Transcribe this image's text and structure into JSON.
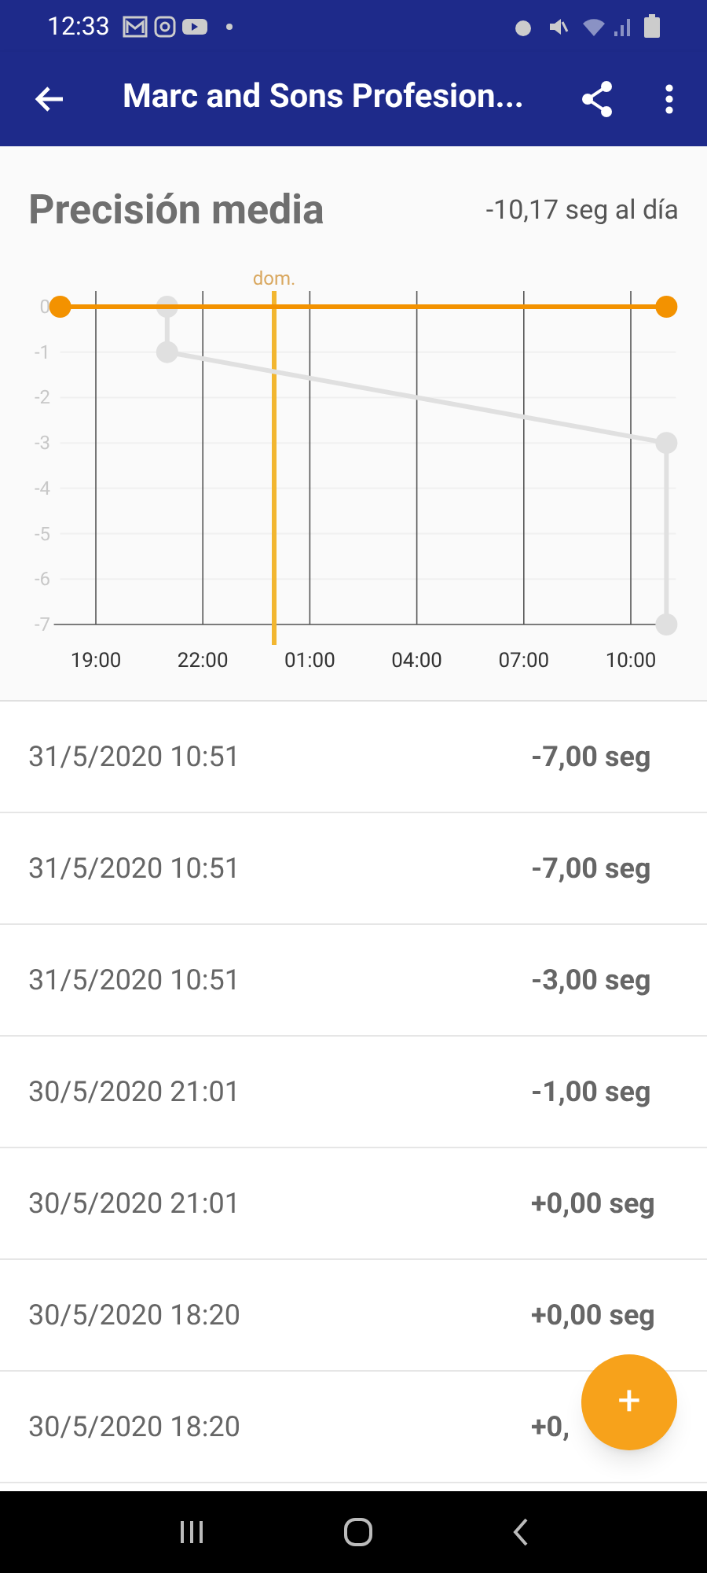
{
  "status_bar": {
    "time": "12:33"
  },
  "app_bar": {
    "title": "Marc and Sons Profesion..."
  },
  "summary": {
    "title": "Precisión media",
    "value": "-10,17 seg al día"
  },
  "chart": {
    "chart_data": {
      "type": "line",
      "grid": true,
      "categories": [
        null,
        "19:00",
        null,
        null,
        "22:00",
        null,
        null,
        "01:00",
        null,
        null,
        "04:00",
        null,
        null,
        "07:00",
        null,
        null,
        "10:00",
        null
      ],
      "ylim": [
        -7,
        0
      ],
      "yticks": [
        0,
        -1,
        -2,
        -3,
        -4,
        -5,
        -6,
        -7
      ],
      "series": [
        {
          "color": "#f39200",
          "marker": "circle",
          "values": [
            0,
            null,
            null,
            null,
            null,
            null,
            null,
            null,
            null,
            null,
            null,
            null,
            null,
            null,
            null,
            null,
            null,
            0
          ]
        },
        {
          "color": "#e0e0e0",
          "marker": "circle",
          "values": [
            null,
            null,
            null,
            -1,
            null,
            null,
            null,
            null,
            null,
            null,
            null,
            null,
            null,
            null,
            null,
            null,
            null,
            -3
          ]
        },
        {
          "color": "#e0e0e0",
          "marker": "circle",
          "values": [
            null,
            null,
            null,
            0,
            null,
            null,
            null,
            null,
            null,
            null,
            null,
            null,
            null,
            null,
            null,
            null,
            null,
            null
          ]
        },
        {
          "color": "#e0e0e0",
          "marker": "circle",
          "values": [
            null,
            null,
            null,
            null,
            null,
            null,
            null,
            null,
            null,
            null,
            null,
            null,
            null,
            null,
            null,
            null,
            null,
            -7
          ]
        }
      ],
      "annotations": [
        "dom."
      ]
    }
  },
  "entries": [
    {
      "date": "31/5/2020 10:51",
      "value": "-7,00 seg"
    },
    {
      "date": "31/5/2020 10:51",
      "value": "-7,00 seg"
    },
    {
      "date": "31/5/2020 10:51",
      "value": "-3,00 seg"
    },
    {
      "date": "30/5/2020 21:01",
      "value": "-1,00 seg"
    },
    {
      "date": "30/5/2020 21:01",
      "value": "+0,00 seg"
    },
    {
      "date": "30/5/2020 18:20",
      "value": "+0,00 seg"
    },
    {
      "date": "30/5/2020 18:20",
      "value": "+0,"
    }
  ],
  "fab": {
    "label": "+"
  }
}
